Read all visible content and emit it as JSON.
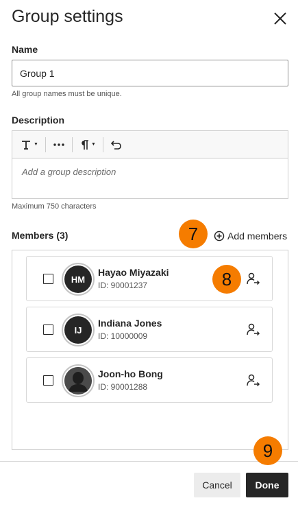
{
  "dialog": {
    "title": "Group settings"
  },
  "name_field": {
    "label": "Name",
    "value": "Group 1",
    "hint": "All group names must be unique."
  },
  "description_field": {
    "label": "Description",
    "placeholder": "Add a group description",
    "hint": "Maximum 750 characters",
    "toolbar": [
      "text-format-icon",
      "more-icon",
      "paragraph-icon",
      "undo-icon"
    ]
  },
  "members": {
    "heading": "Members (3)",
    "add_label": "Add members",
    "list": [
      {
        "name": "Hayao Miyazaki",
        "id": "ID: 90001237",
        "initials": "HM"
      },
      {
        "name": "Indiana Jones",
        "id": "ID: 10000009",
        "initials": "IJ"
      },
      {
        "name": "Joon-ho Bong",
        "id": "ID: 90001288",
        "initials": ""
      }
    ]
  },
  "callouts": [
    "7",
    "8",
    "9"
  ],
  "footer": {
    "cancel_label": "Cancel",
    "done_label": "Done"
  },
  "colors": {
    "callout": "#f57c00",
    "primary_button": "#262626"
  }
}
